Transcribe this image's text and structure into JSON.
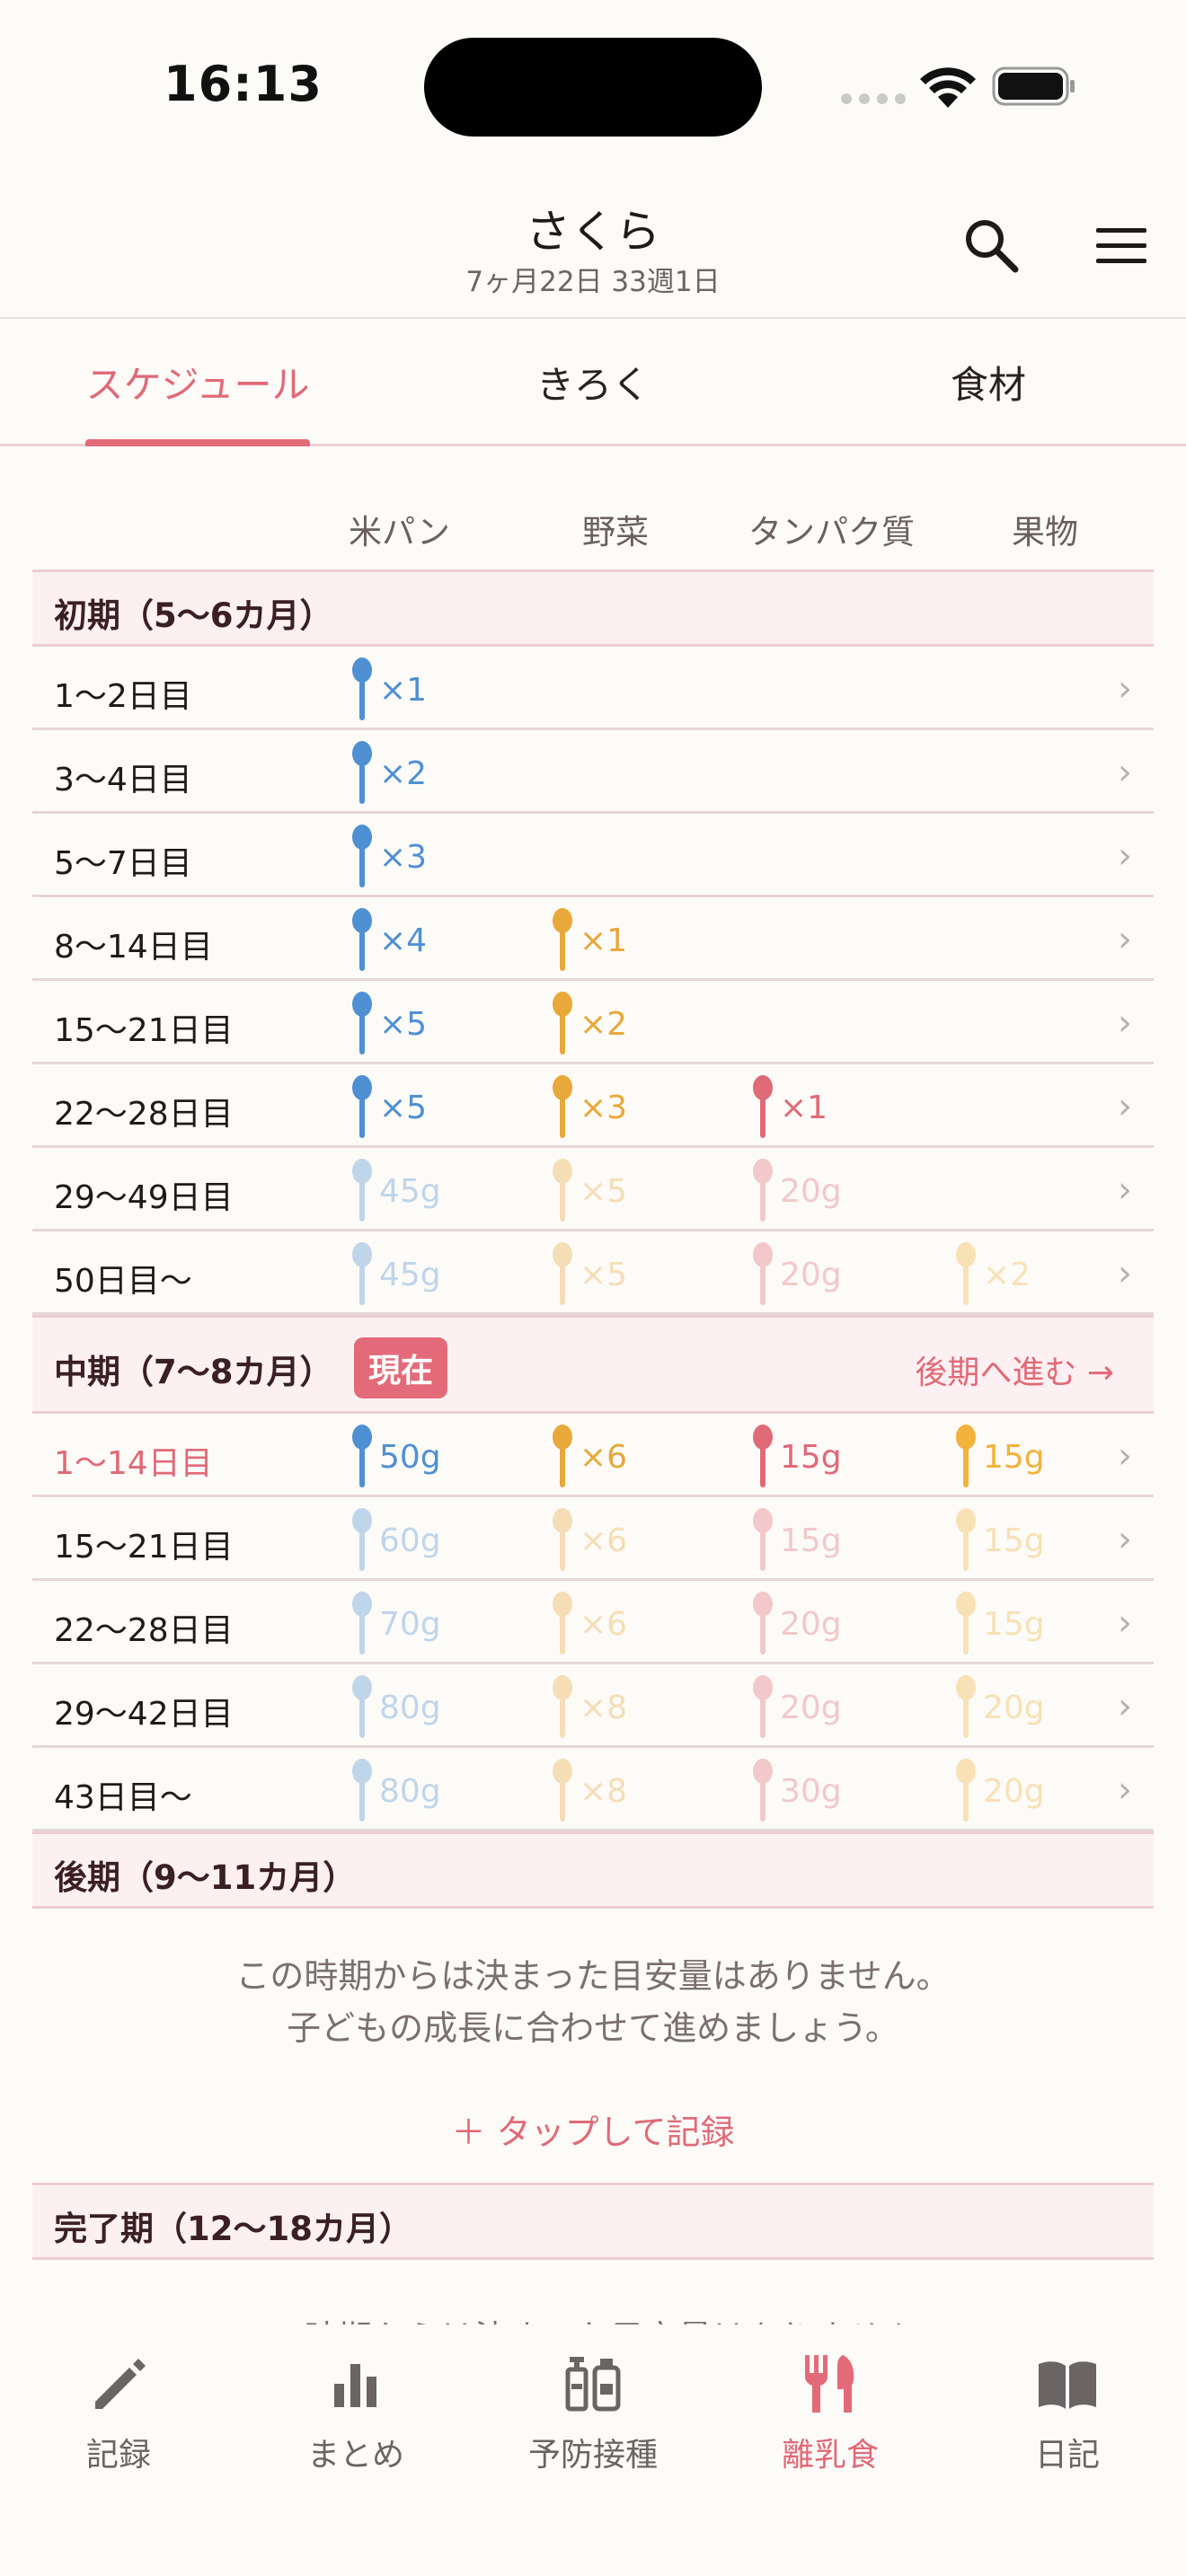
{
  "status": {
    "time": "16:13"
  },
  "header": {
    "name": "さくら",
    "age": "7ヶ月22日  33週1日"
  },
  "tabs": [
    "スケジュール",
    "きろく",
    "食材"
  ],
  "columns": [
    "米パン",
    "野菜",
    "タンパク質",
    "果物"
  ],
  "colors": {
    "grain": "#4f90d3",
    "veg": "#e9a83a",
    "protein": "#e06a78",
    "fruit": "#f2b23c",
    "accent": "#e36b79"
  },
  "sections": {
    "early": {
      "title": "初期（5〜6カ月）"
    },
    "middle": {
      "title": "中期（7〜8カ月）",
      "badge": "現在",
      "advance": "後期へ進む →"
    },
    "late": {
      "title": "後期（9〜11カ月）",
      "note1": "この時期からは決まった目安量はありません。",
      "note2": "子どもの成長に合わせて進めましょう。",
      "action": "＋ タップして記録"
    },
    "final": {
      "title": "完了期（12〜18カ月）",
      "note1": "この時期からは決まった目安量はありません。"
    }
  },
  "early_rows": [
    {
      "label": "1〜2日目",
      "grain": "×1"
    },
    {
      "label": "3〜4日目",
      "grain": "×2"
    },
    {
      "label": "5〜7日目",
      "grain": "×3"
    },
    {
      "label": "8〜14日目",
      "grain": "×4",
      "veg": "×1"
    },
    {
      "label": "15〜21日目",
      "grain": "×5",
      "veg": "×2"
    },
    {
      "label": "22〜28日目",
      "grain": "×5",
      "veg": "×3",
      "protein": "×1"
    },
    {
      "label": "29〜49日目",
      "grain": "45g",
      "veg": "×5",
      "protein": "20g"
    },
    {
      "label": "50日目〜",
      "grain": "45g",
      "veg": "×5",
      "protein": "20g",
      "fruit": "×2"
    }
  ],
  "middle_rows": [
    {
      "label": "1〜14日目",
      "grain": "50g",
      "veg": "×6",
      "protein": "15g",
      "fruit": "15g"
    },
    {
      "label": "15〜21日目",
      "grain": "60g",
      "veg": "×6",
      "protein": "15g",
      "fruit": "15g"
    },
    {
      "label": "22〜28日目",
      "grain": "70g",
      "veg": "×6",
      "protein": "20g",
      "fruit": "15g"
    },
    {
      "label": "29〜42日目",
      "grain": "80g",
      "veg": "×8",
      "protein": "20g",
      "fruit": "20g"
    },
    {
      "label": "43日目〜",
      "grain": "80g",
      "veg": "×8",
      "protein": "30g",
      "fruit": "20g"
    }
  ],
  "nav": [
    "記録",
    "まとめ",
    "予防接種",
    "離乳食",
    "日記"
  ]
}
